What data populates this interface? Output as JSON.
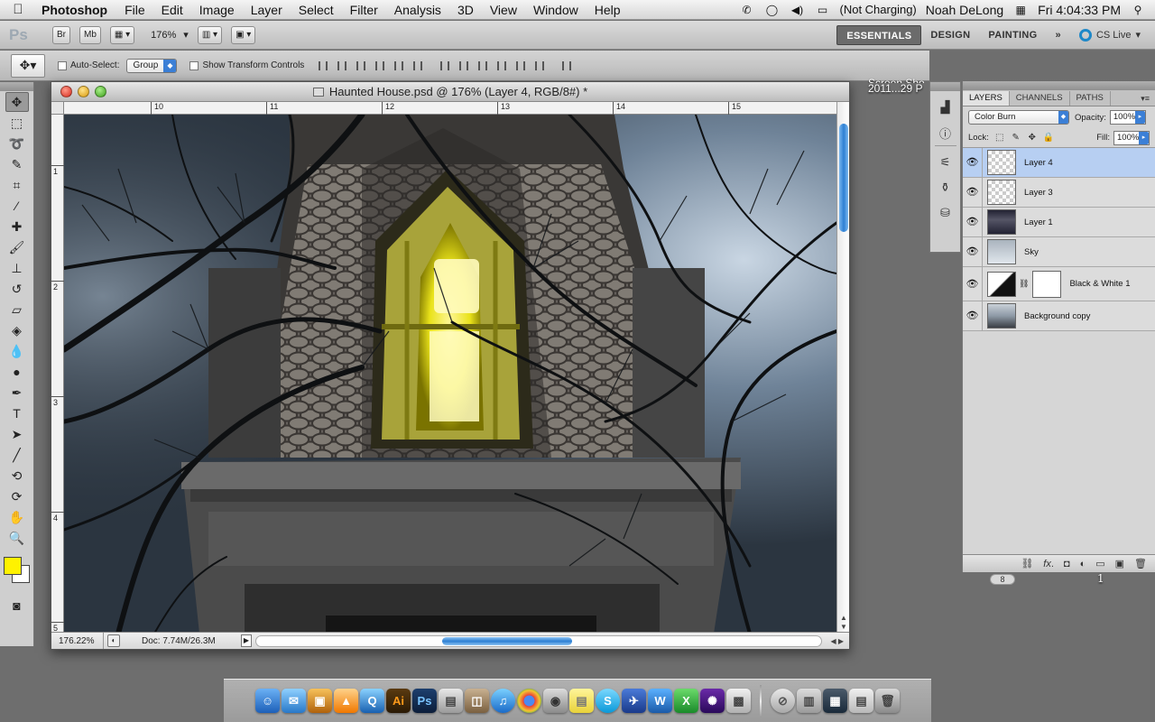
{
  "menubar": {
    "apple": "",
    "app_name": "Photoshop",
    "items": [
      "File",
      "Edit",
      "Image",
      "Layer",
      "Select",
      "Filter",
      "Analysis",
      "3D",
      "View",
      "Window",
      "Help"
    ],
    "battery": "(Not Charging)",
    "user": "Noah DeLong",
    "clock": "Fri 4:04:33 PM"
  },
  "appbar": {
    "logo": "Ps",
    "bridge_label": "Br",
    "minibridge_label": "Mb",
    "zoom": "176%",
    "workspaces": [
      "ESSENTIALS",
      "DESIGN",
      "PAINTING"
    ],
    "more": "»",
    "cs_live": "CS Live"
  },
  "optionsbar": {
    "auto_select_label": "Auto-Select:",
    "auto_select_value": "Group",
    "transform_label": "Show Transform Controls"
  },
  "document": {
    "title": "Haunted House.psd @ 176% (Layer 4, RGB/8#) *",
    "ruler_h": [
      "10",
      "11",
      "12",
      "13",
      "14",
      "15"
    ],
    "ruler_v": [
      "1",
      "2",
      "3",
      "4",
      "5"
    ],
    "zoom_status": "176.22%",
    "doc_size": "Doc: 7.74M/26.3M"
  },
  "desktop_text": [
    "Screen Sho",
    "2011...29 P"
  ],
  "layers_panel": {
    "tabs": [
      "LAYERS",
      "CHANNELS",
      "PATHS"
    ],
    "blend_mode": "Color Burn",
    "opacity_label": "Opacity:",
    "opacity": "100%",
    "lock_label": "Lock:",
    "fill_label": "Fill:",
    "fill": "100%",
    "layers": [
      {
        "name": "Layer 4",
        "selected": true
      },
      {
        "name": "Layer 3",
        "selected": false
      },
      {
        "name": "Layer 1",
        "selected": false
      },
      {
        "name": "Sky",
        "selected": false
      },
      {
        "name": "Black & White 1",
        "selected": false
      },
      {
        "name": "Background copy",
        "selected": false
      }
    ],
    "footer_icons": [
      "link-icon",
      "fx-icon",
      "mask-icon",
      "adjustment-icon",
      "folder-icon",
      "new-layer-icon",
      "trash-icon"
    ]
  },
  "desktop_numbers": [
    "8",
    "1"
  ],
  "colors": {
    "foreground": "#fff200",
    "background": "#ffffff",
    "selection": "#b7cff2",
    "accent": "#2d7fd3"
  }
}
